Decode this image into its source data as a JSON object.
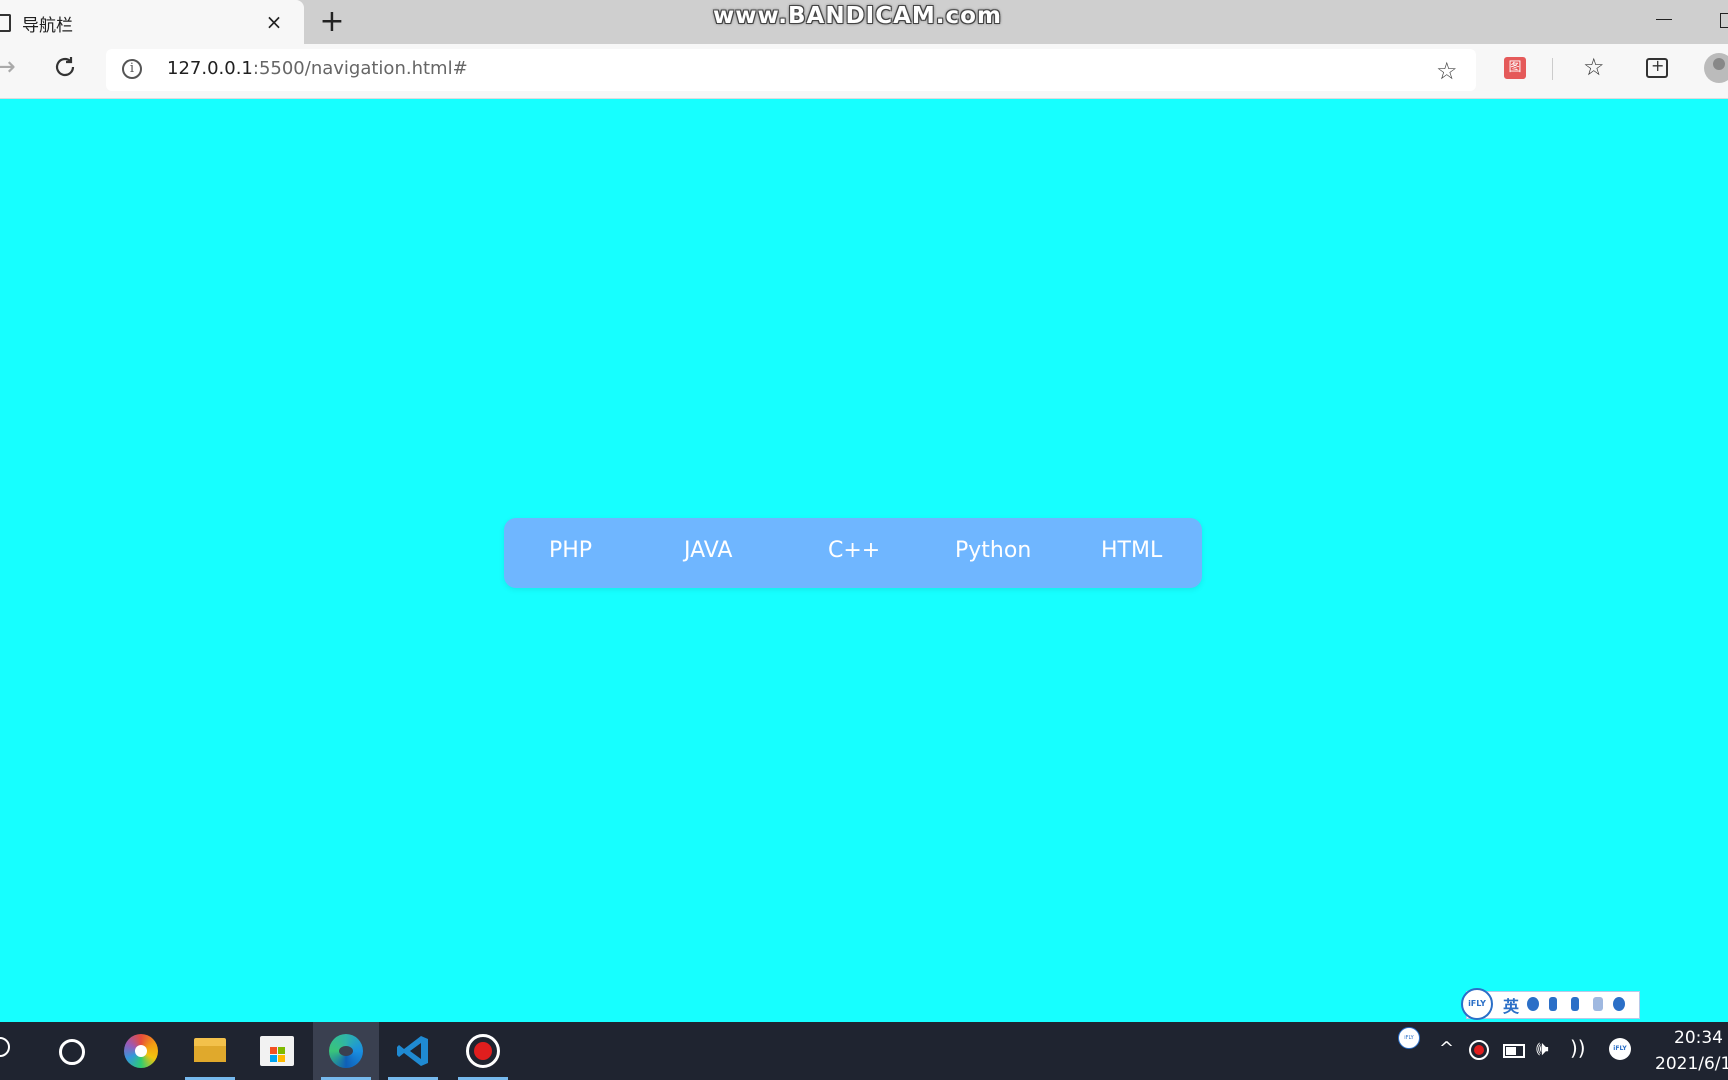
{
  "browser": {
    "tab_title": "导航栏",
    "tab_close": "×",
    "new_tab": "+",
    "url_host": "127.0.0.1",
    "url_rest": ":5500/navigation.html#",
    "info_glyph": "i",
    "ext_label": "图",
    "watermark": "www.BANDICAM.com",
    "icons": [
      "page-icon",
      "close-icon",
      "plus-icon",
      "minimize-icon",
      "maximize-icon",
      "forward-icon",
      "refresh-icon",
      "info-icon",
      "favorite-add-icon",
      "extension-icon",
      "favorites-icon",
      "collections-icon",
      "profile-icon"
    ]
  },
  "page": {
    "background": "#16ffff",
    "nav_background": "#6fb6ff",
    "nav_items": [
      "PHP",
      "JAVA",
      "C++",
      "Python",
      "HTML"
    ]
  },
  "ime": {
    "logo": "iFLY",
    "mode": "英"
  },
  "taskbar": {
    "apps": [
      "search",
      "cortana",
      "pinwheel-app",
      "file-explorer",
      "microsoft-store",
      "edge",
      "vscode",
      "bandicam"
    ],
    "clock_time": "20:34",
    "clock_date": "2021/6/1"
  }
}
